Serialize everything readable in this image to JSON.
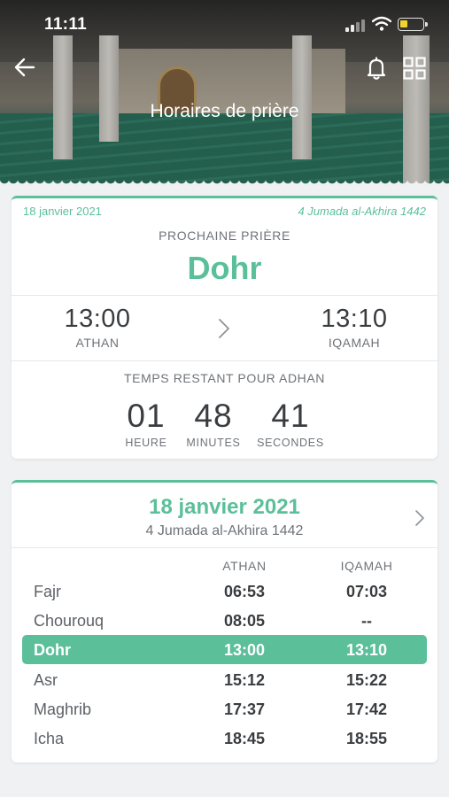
{
  "status_bar": {
    "time": "11:11"
  },
  "header": {
    "title": "Horaires de prière"
  },
  "next_prayer_card": {
    "gregorian_date": "18 janvier 2021",
    "hijri_date": "4 Jumada al-Akhira 1442",
    "label": "PROCHAINE PRIÈRE",
    "prayer_name": "Dohr",
    "athan_time": "13:00",
    "athan_label": "ATHAN",
    "iqamah_time": "13:10",
    "iqamah_label": "IQAMAH",
    "remaining_label": "TEMPS RESTANT POUR ADHAN",
    "countdown": [
      {
        "value": "01",
        "unit": "HEURE"
      },
      {
        "value": "48",
        "unit": "MINUTES"
      },
      {
        "value": "41",
        "unit": "SECONDES"
      }
    ]
  },
  "day_card": {
    "gregorian_date": "18 janvier 2021",
    "hijri_date": "4 Jumada al-Akhira 1442",
    "columns": {
      "athan": "ATHAN",
      "iqamah": "IQAMAH"
    },
    "prayers": [
      {
        "name": "Fajr",
        "athan": "06:53",
        "iqamah": "07:03",
        "active": false
      },
      {
        "name": "Chourouq",
        "athan": "08:05",
        "iqamah": "--",
        "active": false
      },
      {
        "name": "Dohr",
        "athan": "13:00",
        "iqamah": "13:10",
        "active": true
      },
      {
        "name": "Asr",
        "athan": "15:12",
        "iqamah": "15:22",
        "active": false
      },
      {
        "name": "Maghrib",
        "athan": "17:37",
        "iqamah": "17:42",
        "active": false
      },
      {
        "name": "Icha",
        "athan": "18:45",
        "iqamah": "18:55",
        "active": false
      }
    ]
  },
  "colors": {
    "accent": "#5bbf9a",
    "background": "#eff1f3",
    "text": "#3a3d40",
    "muted": "#6f7378"
  },
  "icons": [
    "back-arrow-icon",
    "bell-icon",
    "grid-icon",
    "chevron-right-icon",
    "signal-icon",
    "wifi-icon",
    "battery-icon"
  ]
}
